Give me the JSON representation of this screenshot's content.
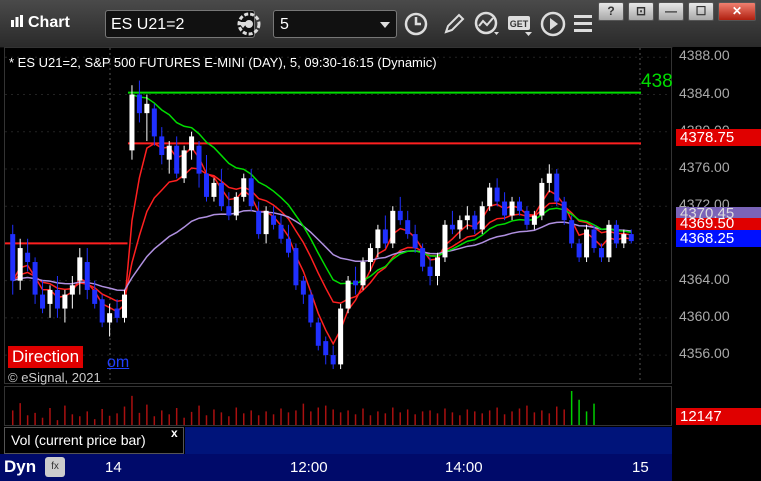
{
  "window": {
    "title": "Chart",
    "symbol": "ES U21=2",
    "interval": "5",
    "buttons": {
      "help": "?",
      "restore": "⊡",
      "minimize": "—",
      "maximize": "☐",
      "close": "✕"
    }
  },
  "chart_header": "* ES U21=2, S&P 500 FUTURES E-MINI (DAY), 5, 09:30-16:15 (Dynamic)",
  "direction_label": "Direction",
  "link_tail": "om",
  "copyright": "© eSignal, 2021",
  "green_level_label": "438",
  "price_axis": {
    "ticks": [
      "4388.00",
      "4384.00",
      "4380.00",
      "4376.00",
      "4372.00",
      "4368.00",
      "4364.00",
      "4360.00",
      "4356.00"
    ],
    "tags": {
      "red_level": "4378.75",
      "purple_level": "4370.45",
      "red_overlap": "4369.50",
      "last_price": "4368.25",
      "volume": "12147"
    }
  },
  "volume_panel": {
    "label": "Vol (current price bar)",
    "close": "x"
  },
  "time_axis": [
    "14",
    "12:00",
    "14:00",
    "15"
  ],
  "bottom": {
    "dyn": "Dyn",
    "fx": "fx"
  },
  "colors": {
    "red_line": "#ff2020",
    "green_line": "#00dd00",
    "purple_line": "#b090e0",
    "bull": "#ffffff",
    "bear": "#2030ff"
  },
  "chart_data": {
    "type": "candlestick",
    "ylim": [
      4353,
      4389
    ],
    "levels": {
      "green": 4384.2,
      "red": 4378.75,
      "red_previous": 4368.0
    },
    "candles": [
      [
        4369.0,
        4370.0,
        4362.5,
        4364.0
      ],
      [
        4364.0,
        4368.5,
        4363.0,
        4367.5
      ],
      [
        4367.0,
        4368.5,
        4365.0,
        4366.0
      ],
      [
        4366.0,
        4366.5,
        4361.5,
        4362.5
      ],
      [
        4362.5,
        4364.0,
        4360.5,
        4361.0
      ],
      [
        4361.5,
        4363.5,
        4360.0,
        4363.0
      ],
      [
        4363.0,
        4364.5,
        4360.0,
        4361.0
      ],
      [
        4361.0,
        4363.0,
        4359.5,
        4362.5
      ],
      [
        4362.5,
        4364.5,
        4361.0,
        4363.5
      ],
      [
        4364.0,
        4367.5,
        4362.5,
        4366.5
      ],
      [
        4366.0,
        4367.5,
        4362.0,
        4363.0
      ],
      [
        4363.0,
        4364.0,
        4361.0,
        4361.5
      ],
      [
        4362.0,
        4362.5,
        4359.0,
        4359.5
      ],
      [
        4359.5,
        4361.5,
        4358.0,
        4360.5
      ],
      [
        4361.0,
        4362.0,
        4359.5,
        4360.0
      ],
      [
        4360.0,
        4363.0,
        4359.5,
        4362.5
      ],
      [
        4378.0,
        4385.0,
        4377.0,
        4384.0
      ],
      [
        4384.0,
        4385.5,
        4381.0,
        4382.0
      ],
      [
        4382.0,
        4384.0,
        4379.0,
        4383.0
      ],
      [
        4382.5,
        4383.0,
        4378.5,
        4379.5
      ],
      [
        4379.5,
        4380.5,
        4376.5,
        4377.5
      ],
      [
        4377.0,
        4379.0,
        4375.5,
        4378.5
      ],
      [
        4378.5,
        4379.5,
        4375.0,
        4375.5
      ],
      [
        4375.0,
        4378.5,
        4374.5,
        4378.0
      ],
      [
        4378.0,
        4380.0,
        4377.0,
        4379.5
      ],
      [
        4378.5,
        4379.0,
        4374.0,
        4375.5
      ],
      [
        4375.5,
        4377.5,
        4372.5,
        4373.0
      ],
      [
        4373.0,
        4375.0,
        4372.5,
        4374.5
      ],
      [
        4374.5,
        4376.0,
        4371.5,
        4372.0
      ],
      [
        4372.0,
        4373.5,
        4370.5,
        4371.0
      ],
      [
        4371.0,
        4373.5,
        4370.5,
        4373.0
      ],
      [
        4373.0,
        4375.5,
        4372.5,
        4375.0
      ],
      [
        4375.0,
        4376.0,
        4371.5,
        4372.0
      ],
      [
        4371.5,
        4372.5,
        4368.5,
        4369.0
      ],
      [
        4369.0,
        4372.0,
        4368.0,
        4371.5
      ],
      [
        4371.0,
        4372.0,
        4369.5,
        4370.0
      ],
      [
        4370.0,
        4371.0,
        4368.0,
        4368.5
      ],
      [
        4368.5,
        4370.0,
        4366.5,
        4367.0
      ],
      [
        4367.5,
        4368.0,
        4363.0,
        4363.5
      ],
      [
        4364.0,
        4364.5,
        4361.5,
        4362.5
      ],
      [
        4362.5,
        4363.0,
        4359.0,
        4359.5
      ],
      [
        4359.5,
        4360.0,
        4356.5,
        4357.0
      ],
      [
        4357.5,
        4358.0,
        4355.0,
        4356.0
      ],
      [
        4356.0,
        4357.0,
        4354.5,
        4355.0
      ],
      [
        4355.0,
        4361.5,
        4354.5,
        4361.0
      ],
      [
        4361.0,
        4364.5,
        4360.5,
        4364.0
      ],
      [
        4364.0,
        4365.5,
        4362.5,
        4363.5
      ],
      [
        4363.5,
        4366.5,
        4363.0,
        4366.0
      ],
      [
        4366.0,
        4368.0,
        4365.0,
        4367.5
      ],
      [
        4367.5,
        4370.0,
        4366.5,
        4369.5
      ],
      [
        4369.5,
        4371.0,
        4367.5,
        4368.0
      ],
      [
        4368.0,
        4372.0,
        4367.5,
        4371.5
      ],
      [
        4371.5,
        4373.0,
        4370.0,
        4370.5
      ],
      [
        4370.5,
        4371.5,
        4368.5,
        4369.0
      ],
      [
        4369.0,
        4370.0,
        4367.0,
        4367.5
      ],
      [
        4367.5,
        4368.0,
        4365.0,
        4365.5
      ],
      [
        4365.5,
        4366.5,
        4363.5,
        4364.5
      ],
      [
        4364.5,
        4367.0,
        4363.5,
        4366.5
      ],
      [
        4366.5,
        4370.5,
        4366.0,
        4370.0
      ],
      [
        4370.0,
        4371.5,
        4369.0,
        4369.5
      ],
      [
        4369.5,
        4371.0,
        4368.5,
        4370.5
      ],
      [
        4370.5,
        4372.0,
        4369.5,
        4371.0
      ],
      [
        4371.0,
        4371.5,
        4369.0,
        4369.5
      ],
      [
        4369.5,
        4372.5,
        4369.0,
        4372.0
      ],
      [
        4372.0,
        4374.5,
        4371.5,
        4374.0
      ],
      [
        4374.0,
        4375.0,
        4372.0,
        4372.5
      ],
      [
        4372.5,
        4373.5,
        4370.5,
        4371.0
      ],
      [
        4371.0,
        4373.0,
        4370.5,
        4372.5
      ],
      [
        4372.5,
        4373.0,
        4371.0,
        4371.5
      ],
      [
        4371.5,
        4372.0,
        4369.5,
        4370.0
      ],
      [
        4370.0,
        4371.5,
        4369.5,
        4371.0
      ],
      [
        4371.0,
        4375.0,
        4370.5,
        4374.5
      ],
      [
        4374.5,
        4376.5,
        4373.5,
        4375.5
      ],
      [
        4375.5,
        4376.0,
        4372.0,
        4372.5
      ],
      [
        4372.5,
        4373.0,
        4370.0,
        4370.5
      ],
      [
        4370.5,
        4371.0,
        4367.5,
        4368.0
      ],
      [
        4368.0,
        4368.5,
        4366.0,
        4366.5
      ],
      [
        4366.5,
        4370.0,
        4366.0,
        4369.5
      ],
      [
        4369.5,
        4370.0,
        4367.0,
        4367.5
      ],
      [
        4367.5,
        4368.0,
        4366.0,
        4366.5
      ],
      [
        4366.5,
        4370.5,
        4366.0,
        4370.0
      ],
      [
        4370.0,
        4370.5,
        4367.5,
        4368.0
      ],
      [
        4368.0,
        4369.5,
        4367.5,
        4369.0
      ],
      [
        4369.0,
        4369.5,
        4368.0,
        4368.25
      ]
    ],
    "volume": [
      30,
      45,
      20,
      25,
      15,
      35,
      10,
      40,
      22,
      18,
      28,
      12,
      33,
      19,
      24,
      38,
      60,
      25,
      42,
      18,
      30,
      22,
      35,
      15,
      27,
      40,
      20,
      32,
      26,
      18,
      36,
      24,
      30,
      20,
      28,
      22,
      34,
      26,
      30,
      44,
      28,
      36,
      40,
      32,
      26,
      30,
      22,
      34,
      20,
      28,
      24,
      36,
      26,
      32,
      22,
      28,
      30,
      24,
      34,
      26,
      20,
      32,
      28,
      24,
      30,
      36,
      22,
      28,
      34,
      40,
      26,
      30,
      24,
      38,
      32,
      70,
      52,
      28,
      44
    ]
  }
}
